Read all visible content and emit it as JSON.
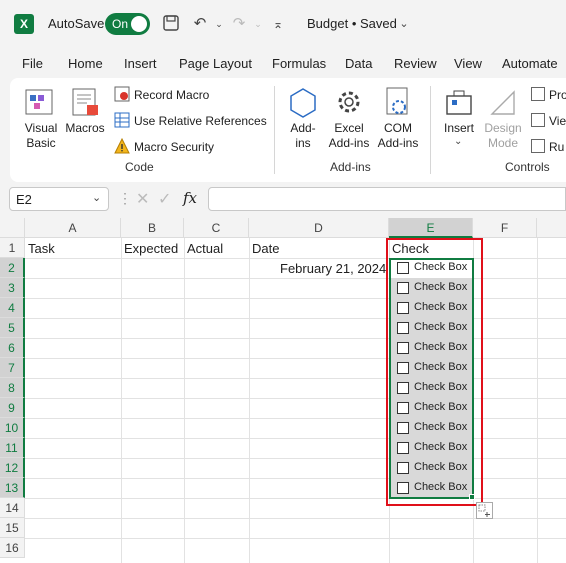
{
  "titlebar": {
    "autosave_label": "AutoSave",
    "autosave_state": "On",
    "doc_title": "Budget • Saved"
  },
  "menu": [
    "File",
    "Home",
    "Insert",
    "Page Layout",
    "Formulas",
    "Data",
    "Review",
    "View",
    "Automate"
  ],
  "ribbon": {
    "visual_basic": "Visual\nBasic",
    "macros": "Macros",
    "record_macro": "Record Macro",
    "relative_refs": "Use Relative References",
    "macro_security": "Macro Security",
    "code_group": "Code",
    "addins": "Add-\nins",
    "excel_addins": "Excel\nAdd-ins",
    "com_addins": "COM\nAdd-ins",
    "addins_group": "Add-ins",
    "insert": "Insert",
    "design_mode": "Design\nMode",
    "controls_group": "Controls",
    "properties": "Pro",
    "view_code": "Vie",
    "run_dialog": "Ru"
  },
  "formula_bar": {
    "name_box": "E2",
    "fx": "fx",
    "value": ""
  },
  "columns": [
    "A",
    "B",
    "C",
    "D",
    "E",
    "F"
  ],
  "rows": [
    "1",
    "2",
    "3",
    "4",
    "5",
    "6",
    "7",
    "8",
    "9",
    "10",
    "11",
    "12",
    "13",
    "14",
    "15",
    "16"
  ],
  "headers": {
    "task": "Task",
    "expected": "Expected",
    "actual": "Actual",
    "date": "Date",
    "check": "Check"
  },
  "date_value": "February 21, 2024",
  "checkbox_label": "Check Box",
  "colors": {
    "excel_green": "#107c41",
    "selection_red": "#e0101a"
  }
}
